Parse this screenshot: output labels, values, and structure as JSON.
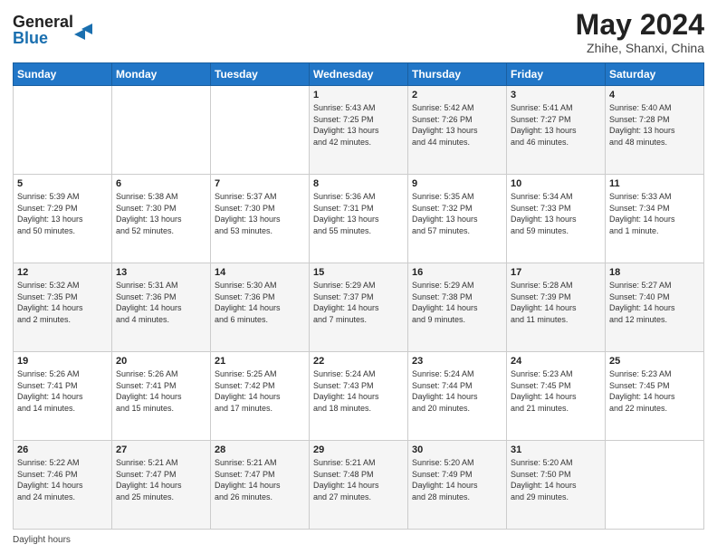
{
  "header": {
    "logo_line1": "General",
    "logo_line2": "Blue",
    "month_title": "May 2024",
    "location": "Zhihe, Shanxi, China"
  },
  "calendar": {
    "days_of_week": [
      "Sunday",
      "Monday",
      "Tuesday",
      "Wednesday",
      "Thursday",
      "Friday",
      "Saturday"
    ],
    "weeks": [
      [
        {
          "day": "",
          "info": ""
        },
        {
          "day": "",
          "info": ""
        },
        {
          "day": "",
          "info": ""
        },
        {
          "day": "1",
          "info": "Sunrise: 5:43 AM\nSunset: 7:25 PM\nDaylight: 13 hours\nand 42 minutes."
        },
        {
          "day": "2",
          "info": "Sunrise: 5:42 AM\nSunset: 7:26 PM\nDaylight: 13 hours\nand 44 minutes."
        },
        {
          "day": "3",
          "info": "Sunrise: 5:41 AM\nSunset: 7:27 PM\nDaylight: 13 hours\nand 46 minutes."
        },
        {
          "day": "4",
          "info": "Sunrise: 5:40 AM\nSunset: 7:28 PM\nDaylight: 13 hours\nand 48 minutes."
        }
      ],
      [
        {
          "day": "5",
          "info": "Sunrise: 5:39 AM\nSunset: 7:29 PM\nDaylight: 13 hours\nand 50 minutes."
        },
        {
          "day": "6",
          "info": "Sunrise: 5:38 AM\nSunset: 7:30 PM\nDaylight: 13 hours\nand 52 minutes."
        },
        {
          "day": "7",
          "info": "Sunrise: 5:37 AM\nSunset: 7:30 PM\nDaylight: 13 hours\nand 53 minutes."
        },
        {
          "day": "8",
          "info": "Sunrise: 5:36 AM\nSunset: 7:31 PM\nDaylight: 13 hours\nand 55 minutes."
        },
        {
          "day": "9",
          "info": "Sunrise: 5:35 AM\nSunset: 7:32 PM\nDaylight: 13 hours\nand 57 minutes."
        },
        {
          "day": "10",
          "info": "Sunrise: 5:34 AM\nSunset: 7:33 PM\nDaylight: 13 hours\nand 59 minutes."
        },
        {
          "day": "11",
          "info": "Sunrise: 5:33 AM\nSunset: 7:34 PM\nDaylight: 14 hours\nand 1 minute."
        }
      ],
      [
        {
          "day": "12",
          "info": "Sunrise: 5:32 AM\nSunset: 7:35 PM\nDaylight: 14 hours\nand 2 minutes."
        },
        {
          "day": "13",
          "info": "Sunrise: 5:31 AM\nSunset: 7:36 PM\nDaylight: 14 hours\nand 4 minutes."
        },
        {
          "day": "14",
          "info": "Sunrise: 5:30 AM\nSunset: 7:36 PM\nDaylight: 14 hours\nand 6 minutes."
        },
        {
          "day": "15",
          "info": "Sunrise: 5:29 AM\nSunset: 7:37 PM\nDaylight: 14 hours\nand 7 minutes."
        },
        {
          "day": "16",
          "info": "Sunrise: 5:29 AM\nSunset: 7:38 PM\nDaylight: 14 hours\nand 9 minutes."
        },
        {
          "day": "17",
          "info": "Sunrise: 5:28 AM\nSunset: 7:39 PM\nDaylight: 14 hours\nand 11 minutes."
        },
        {
          "day": "18",
          "info": "Sunrise: 5:27 AM\nSunset: 7:40 PM\nDaylight: 14 hours\nand 12 minutes."
        }
      ],
      [
        {
          "day": "19",
          "info": "Sunrise: 5:26 AM\nSunset: 7:41 PM\nDaylight: 14 hours\nand 14 minutes."
        },
        {
          "day": "20",
          "info": "Sunrise: 5:26 AM\nSunset: 7:41 PM\nDaylight: 14 hours\nand 15 minutes."
        },
        {
          "day": "21",
          "info": "Sunrise: 5:25 AM\nSunset: 7:42 PM\nDaylight: 14 hours\nand 17 minutes."
        },
        {
          "day": "22",
          "info": "Sunrise: 5:24 AM\nSunset: 7:43 PM\nDaylight: 14 hours\nand 18 minutes."
        },
        {
          "day": "23",
          "info": "Sunrise: 5:24 AM\nSunset: 7:44 PM\nDaylight: 14 hours\nand 20 minutes."
        },
        {
          "day": "24",
          "info": "Sunrise: 5:23 AM\nSunset: 7:45 PM\nDaylight: 14 hours\nand 21 minutes."
        },
        {
          "day": "25",
          "info": "Sunrise: 5:23 AM\nSunset: 7:45 PM\nDaylight: 14 hours\nand 22 minutes."
        }
      ],
      [
        {
          "day": "26",
          "info": "Sunrise: 5:22 AM\nSunset: 7:46 PM\nDaylight: 14 hours\nand 24 minutes."
        },
        {
          "day": "27",
          "info": "Sunrise: 5:21 AM\nSunset: 7:47 PM\nDaylight: 14 hours\nand 25 minutes."
        },
        {
          "day": "28",
          "info": "Sunrise: 5:21 AM\nSunset: 7:47 PM\nDaylight: 14 hours\nand 26 minutes."
        },
        {
          "day": "29",
          "info": "Sunrise: 5:21 AM\nSunset: 7:48 PM\nDaylight: 14 hours\nand 27 minutes."
        },
        {
          "day": "30",
          "info": "Sunrise: 5:20 AM\nSunset: 7:49 PM\nDaylight: 14 hours\nand 28 minutes."
        },
        {
          "day": "31",
          "info": "Sunrise: 5:20 AM\nSunset: 7:50 PM\nDaylight: 14 hours\nand 29 minutes."
        },
        {
          "day": "",
          "info": ""
        }
      ]
    ]
  },
  "footer": {
    "label": "Daylight hours"
  }
}
